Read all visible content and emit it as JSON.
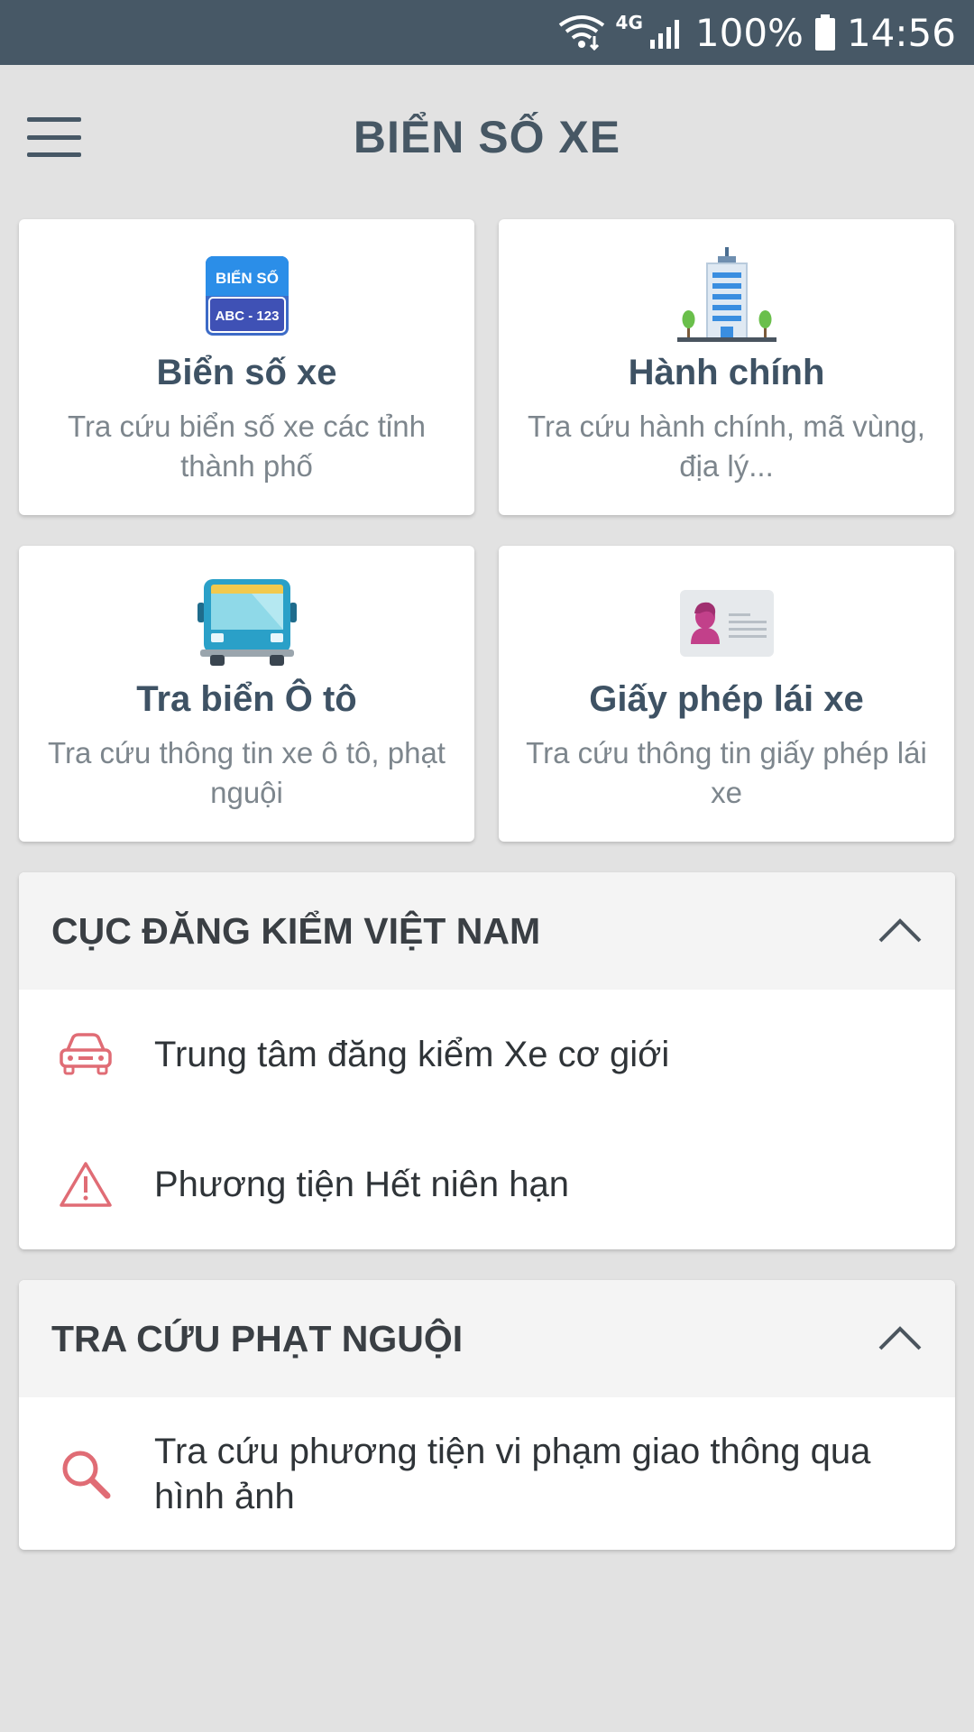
{
  "status_bar": {
    "network": "4G",
    "battery": "100%",
    "time": "14:56"
  },
  "app_bar": {
    "title": "BIỂN SỐ XE"
  },
  "cards": [
    {
      "title": "Biển số xe",
      "description": "Tra cứu biển số xe các tỉnh thành phố",
      "icon": "license-plate-icon",
      "icon_text_top": "BIỂN SỐ",
      "icon_text_bottom": "ABC - 123"
    },
    {
      "title": "Hành chính",
      "description": "Tra cứu hành chính, mã vùng, địa lý...",
      "icon": "building-icon"
    },
    {
      "title": "Tra biển Ô tô",
      "description": "Tra cứu thông tin xe ô tô, phạt nguội",
      "icon": "bus-icon"
    },
    {
      "title": "Giấy phép lái xe",
      "description": "Tra cứu thông tin giấy phép lái xe",
      "icon": "id-card-icon"
    }
  ],
  "sections": [
    {
      "title": "CỤC ĐĂNG KIỂM VIỆT NAM",
      "items": [
        {
          "label": "Trung tâm đăng kiểm Xe cơ giới",
          "icon": "car-icon"
        },
        {
          "label": "Phương tiện Hết niên hạn",
          "icon": "warning-icon"
        }
      ]
    },
    {
      "title": "TRA CỨU PHẠT NGUỘI",
      "items": [
        {
          "label": "Tra cứu phương tiện vi phạm giao thông qua hình ảnh",
          "icon": "search-icon"
        }
      ]
    }
  ],
  "colors": {
    "status_bar": "#475866",
    "background": "#e2e2e2",
    "card_title": "#3e5264",
    "accent_icon": "#e06c75"
  }
}
